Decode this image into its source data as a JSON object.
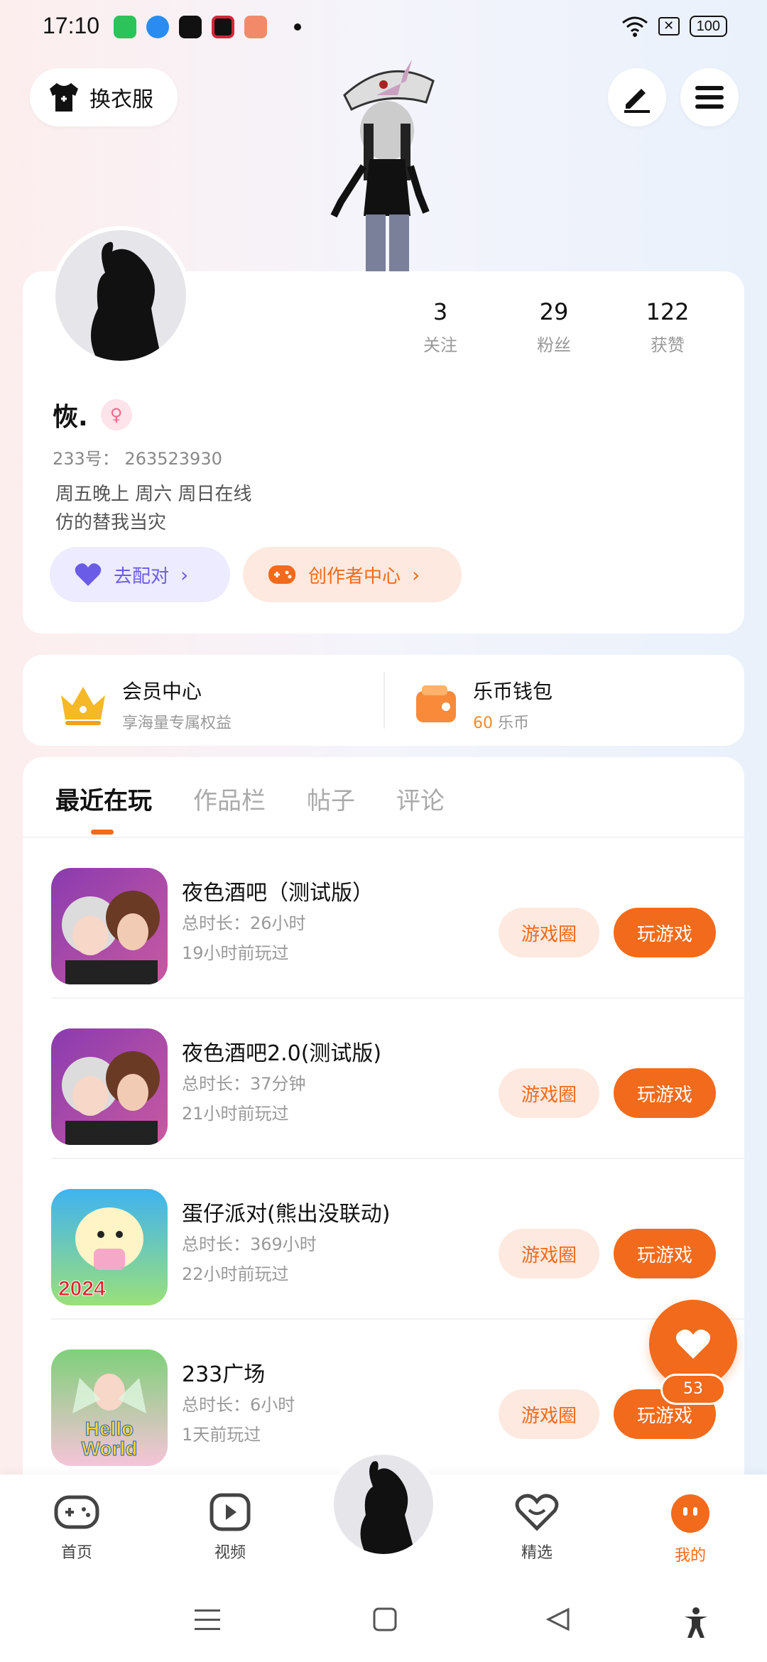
{
  "status_bar": {
    "time": "17:10",
    "battery": "100",
    "app_icons": [
      "wechat-icon",
      "app-blue-icon",
      "tiktok-icon",
      "camera-app-icon",
      "game-app-icon"
    ],
    "colors": {
      "wechat": "#2bc35a",
      "blue_app": "#2a8cf0",
      "tiktok": "#111111",
      "camera": "#d9233a",
      "game": "#f28a6a"
    }
  },
  "header": {
    "outfit_label": "换衣服",
    "edit_icon": "pencil-icon",
    "menu_icon": "hamburger-menu-icon"
  },
  "profile": {
    "stats": [
      {
        "value": "3",
        "label": "关注"
      },
      {
        "value": "29",
        "label": "粉丝"
      },
      {
        "value": "122",
        "label": "获赞"
      }
    ],
    "username": "恢.",
    "gender": "female",
    "uid": "233号： 263523930",
    "bio_lines": [
      "周五晚上 周六 周日在线",
      "仿的替我当灾"
    ],
    "match_button": "去配对",
    "creator_button": "创作者中心"
  },
  "member": {
    "vip_title": "会员中心",
    "vip_sub": "享海量专属权益",
    "wallet_title": "乐币钱包",
    "wallet_amount": "60",
    "wallet_unit": "乐币"
  },
  "tabs": [
    "最近在玩",
    "作品栏",
    "帖子",
    "评论"
  ],
  "games": [
    {
      "name": "夜色酒吧（测试版）",
      "duration": "总时长：26小时",
      "last_played": "19小时前玩过",
      "circle_label": "游戏圈",
      "play_label": "玩游戏"
    },
    {
      "name": "夜色酒吧2.0(测试版)",
      "duration": "总时长：37分钟",
      "last_played": "21小时前玩过",
      "circle_label": "游戏圈",
      "play_label": "玩游戏"
    },
    {
      "name": "蛋仔派对(熊出没联动)",
      "duration": "总时长：369小时",
      "last_played": "22小时前玩过",
      "circle_label": "游戏圈",
      "play_label": "玩游戏"
    },
    {
      "name": "233广场",
      "duration": "总时长：6小时",
      "last_played": "1天前玩过",
      "circle_label": "游戏圈",
      "play_label": "玩游戏"
    }
  ],
  "game_icon_labels": {
    "eggy": "2024",
    "plaza": "Hello World"
  },
  "float_like_count": "53",
  "bottom_nav": [
    {
      "label": "首页",
      "icon": "gamepad-icon"
    },
    {
      "label": "视频",
      "icon": "play-video-icon"
    },
    {
      "label": "精选",
      "icon": "heart-badge-icon"
    },
    {
      "label": "我的",
      "icon": "profile-face-icon"
    }
  ],
  "accent_color": "#f26a1b"
}
